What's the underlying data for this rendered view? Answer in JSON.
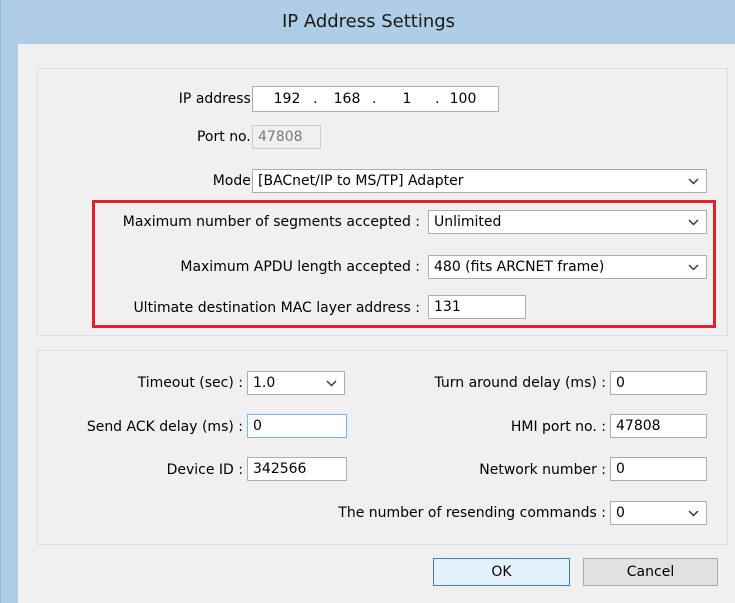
{
  "dialog": {
    "title": "IP Address Settings"
  },
  "ip": {
    "label": "IP address :",
    "octets": [
      "192",
      "168",
      "1",
      "100"
    ],
    "sep": "."
  },
  "port": {
    "label": "Port no. :",
    "value": "47808"
  },
  "mode": {
    "label": "Mode :",
    "value": "[BACnet/IP to MS/TP] Adapter"
  },
  "segments": {
    "label": "Maximum number of segments accepted :",
    "value": "Unlimited"
  },
  "apdu": {
    "label": "Maximum APDU length accepted :",
    "value": "480 (fits ARCNET frame)"
  },
  "mac": {
    "label": "Ultimate destination MAC layer address :",
    "value": "131"
  },
  "timeout": {
    "label": "Timeout (sec) :",
    "value": "1.0"
  },
  "turnaround": {
    "label": "Turn around delay (ms) :",
    "value": "0"
  },
  "ackdelay": {
    "label": "Send ACK delay (ms) :",
    "value": "0"
  },
  "hmiport": {
    "label": "HMI port no. :",
    "value": "47808"
  },
  "deviceid": {
    "label": "Device ID :",
    "value": "342566"
  },
  "network": {
    "label": "Network number :",
    "value": "0"
  },
  "resend": {
    "label": "The number of resending commands :",
    "value": "0"
  },
  "buttons": {
    "ok": "OK",
    "cancel": "Cancel"
  },
  "colors": {
    "highlight": "#e0202a",
    "titlebar": "#aecde6",
    "client": "#f0f0f0"
  }
}
